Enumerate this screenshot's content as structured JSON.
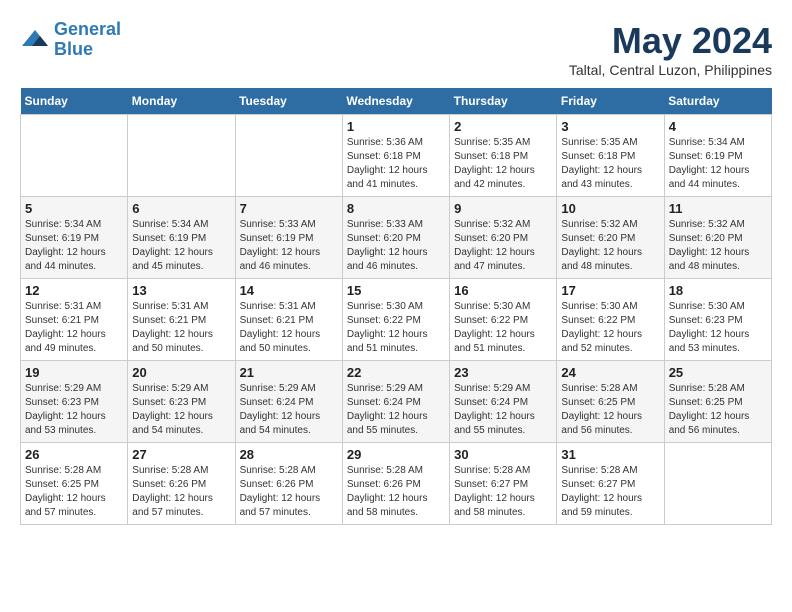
{
  "header": {
    "logo_line1": "General",
    "logo_line2": "Blue",
    "title": "May 2024",
    "subtitle": "Taltal, Central Luzon, Philippines"
  },
  "weekdays": [
    "Sunday",
    "Monday",
    "Tuesday",
    "Wednesday",
    "Thursday",
    "Friday",
    "Saturday"
  ],
  "weeks": [
    [
      {
        "day": "",
        "info": ""
      },
      {
        "day": "",
        "info": ""
      },
      {
        "day": "",
        "info": ""
      },
      {
        "day": "1",
        "info": "Sunrise: 5:36 AM\nSunset: 6:18 PM\nDaylight: 12 hours\nand 41 minutes."
      },
      {
        "day": "2",
        "info": "Sunrise: 5:35 AM\nSunset: 6:18 PM\nDaylight: 12 hours\nand 42 minutes."
      },
      {
        "day": "3",
        "info": "Sunrise: 5:35 AM\nSunset: 6:18 PM\nDaylight: 12 hours\nand 43 minutes."
      },
      {
        "day": "4",
        "info": "Sunrise: 5:34 AM\nSunset: 6:19 PM\nDaylight: 12 hours\nand 44 minutes."
      }
    ],
    [
      {
        "day": "5",
        "info": "Sunrise: 5:34 AM\nSunset: 6:19 PM\nDaylight: 12 hours\nand 44 minutes."
      },
      {
        "day": "6",
        "info": "Sunrise: 5:34 AM\nSunset: 6:19 PM\nDaylight: 12 hours\nand 45 minutes."
      },
      {
        "day": "7",
        "info": "Sunrise: 5:33 AM\nSunset: 6:19 PM\nDaylight: 12 hours\nand 46 minutes."
      },
      {
        "day": "8",
        "info": "Sunrise: 5:33 AM\nSunset: 6:20 PM\nDaylight: 12 hours\nand 46 minutes."
      },
      {
        "day": "9",
        "info": "Sunrise: 5:32 AM\nSunset: 6:20 PM\nDaylight: 12 hours\nand 47 minutes."
      },
      {
        "day": "10",
        "info": "Sunrise: 5:32 AM\nSunset: 6:20 PM\nDaylight: 12 hours\nand 48 minutes."
      },
      {
        "day": "11",
        "info": "Sunrise: 5:32 AM\nSunset: 6:20 PM\nDaylight: 12 hours\nand 48 minutes."
      }
    ],
    [
      {
        "day": "12",
        "info": "Sunrise: 5:31 AM\nSunset: 6:21 PM\nDaylight: 12 hours\nand 49 minutes."
      },
      {
        "day": "13",
        "info": "Sunrise: 5:31 AM\nSunset: 6:21 PM\nDaylight: 12 hours\nand 50 minutes."
      },
      {
        "day": "14",
        "info": "Sunrise: 5:31 AM\nSunset: 6:21 PM\nDaylight: 12 hours\nand 50 minutes."
      },
      {
        "day": "15",
        "info": "Sunrise: 5:30 AM\nSunset: 6:22 PM\nDaylight: 12 hours\nand 51 minutes."
      },
      {
        "day": "16",
        "info": "Sunrise: 5:30 AM\nSunset: 6:22 PM\nDaylight: 12 hours\nand 51 minutes."
      },
      {
        "day": "17",
        "info": "Sunrise: 5:30 AM\nSunset: 6:22 PM\nDaylight: 12 hours\nand 52 minutes."
      },
      {
        "day": "18",
        "info": "Sunrise: 5:30 AM\nSunset: 6:23 PM\nDaylight: 12 hours\nand 53 minutes."
      }
    ],
    [
      {
        "day": "19",
        "info": "Sunrise: 5:29 AM\nSunset: 6:23 PM\nDaylight: 12 hours\nand 53 minutes."
      },
      {
        "day": "20",
        "info": "Sunrise: 5:29 AM\nSunset: 6:23 PM\nDaylight: 12 hours\nand 54 minutes."
      },
      {
        "day": "21",
        "info": "Sunrise: 5:29 AM\nSunset: 6:24 PM\nDaylight: 12 hours\nand 54 minutes."
      },
      {
        "day": "22",
        "info": "Sunrise: 5:29 AM\nSunset: 6:24 PM\nDaylight: 12 hours\nand 55 minutes."
      },
      {
        "day": "23",
        "info": "Sunrise: 5:29 AM\nSunset: 6:24 PM\nDaylight: 12 hours\nand 55 minutes."
      },
      {
        "day": "24",
        "info": "Sunrise: 5:28 AM\nSunset: 6:25 PM\nDaylight: 12 hours\nand 56 minutes."
      },
      {
        "day": "25",
        "info": "Sunrise: 5:28 AM\nSunset: 6:25 PM\nDaylight: 12 hours\nand 56 minutes."
      }
    ],
    [
      {
        "day": "26",
        "info": "Sunrise: 5:28 AM\nSunset: 6:25 PM\nDaylight: 12 hours\nand 57 minutes."
      },
      {
        "day": "27",
        "info": "Sunrise: 5:28 AM\nSunset: 6:26 PM\nDaylight: 12 hours\nand 57 minutes."
      },
      {
        "day": "28",
        "info": "Sunrise: 5:28 AM\nSunset: 6:26 PM\nDaylight: 12 hours\nand 57 minutes."
      },
      {
        "day": "29",
        "info": "Sunrise: 5:28 AM\nSunset: 6:26 PM\nDaylight: 12 hours\nand 58 minutes."
      },
      {
        "day": "30",
        "info": "Sunrise: 5:28 AM\nSunset: 6:27 PM\nDaylight: 12 hours\nand 58 minutes."
      },
      {
        "day": "31",
        "info": "Sunrise: 5:28 AM\nSunset: 6:27 PM\nDaylight: 12 hours\nand 59 minutes."
      },
      {
        "day": "",
        "info": ""
      }
    ]
  ]
}
